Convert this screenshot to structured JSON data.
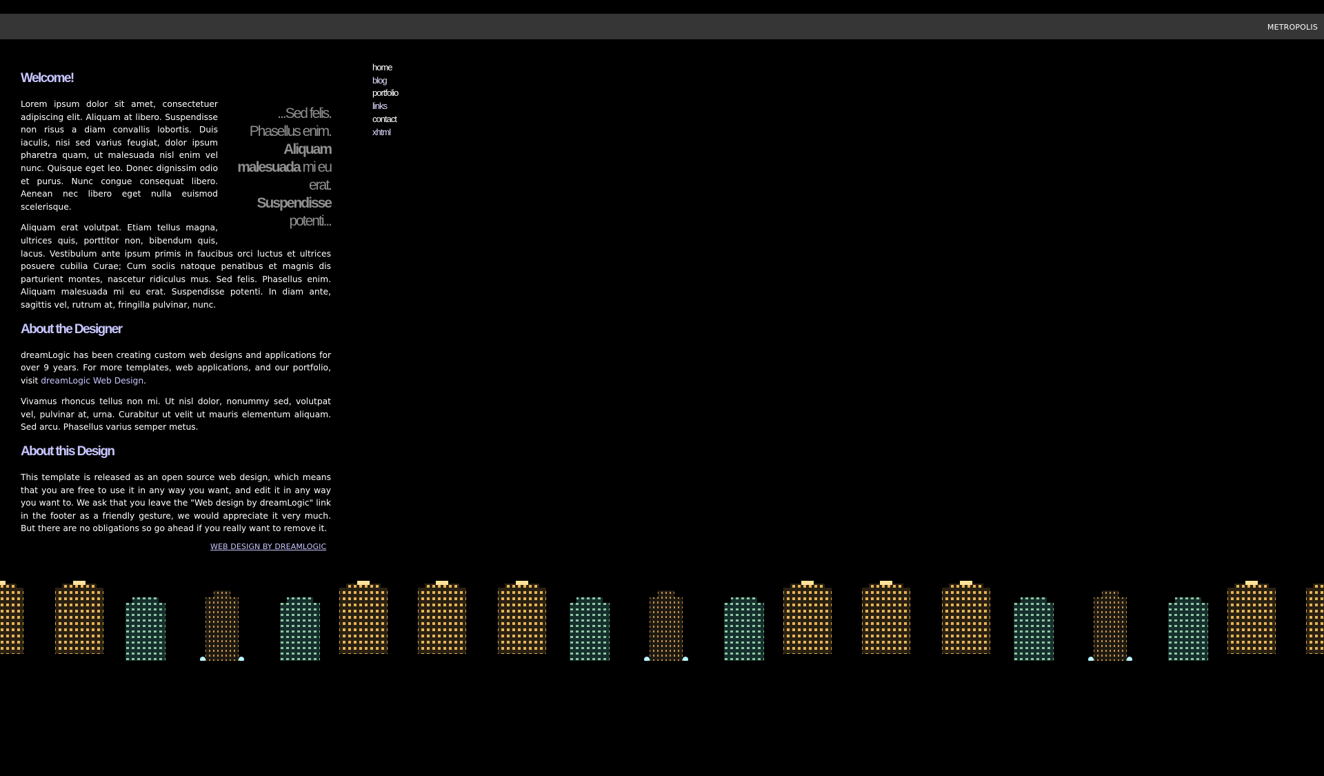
{
  "header": {
    "site_title": "METROPOLIS"
  },
  "main": {
    "welcome": {
      "heading": "Welcome!",
      "pullquote": {
        "line1": "...Sed felis.",
        "line2": "Phasellus enim.",
        "bold1": "Aliquam",
        "bold2": "malesuada",
        "line3": " mi eu",
        "line4": "erat.",
        "bold3": "Suspendisse",
        "line5": "potenti..."
      },
      "p1": "Lorem ipsum dolor sit amet, consectetuer adipiscing elit. Aliquam at libero. Suspendisse non risus a diam convallis lobortis. Duis iaculis, nisi sed varius feugiat, dolor ipsum pharetra quam, ut malesuada nisl enim vel nunc. Quisque eget leo. Donec dignissim odio et purus. Nunc congue consequat libero. Aenean nec libero eget nulla euismod scelerisque.",
      "p2": "Aliquam erat volutpat. Etiam tellus magna, ultrices quis, porttitor non, bibendum quis, lacus. Vestibulum ante ipsum primis in faucibus orci luctus et ultrices posuere cubilia Curae; Cum sociis natoque penatibus et magnis dis parturient montes, nascetur ridiculus mus. Sed felis. Phasellus enim. Aliquam malesuada mi eu erat. Suspendisse potenti. In diam ante, sagittis vel, rutrum at, fringilla pulvinar, nunc."
    },
    "designer": {
      "heading": "About the Designer",
      "p1_before": "dreamLogic has been creating custom web designs and applications for over 9 years. For more templates, web applications, and our portfolio, visit ",
      "p1_link": "dreamLogic Web Design",
      "p1_after": ".",
      "p2": "Vivamus rhoncus tellus non mi. Ut nisl dolor, nonummy sed, volutpat vel, pulvinar at, urna. Curabitur ut velit ut mauris elementum aliquam. Sed arcu. Phasellus varius semper metus."
    },
    "design": {
      "heading": "About this Design",
      "p1": "This template is released as an open source web design, which means that you are free to use it in any way you want, and edit it in any way you want to. We ask that you leave the \"Web design by dreamLogic\" link in the footer as a friendly gesture, we would appreciate it very much. But there are no obligations so go ahead if you really want to remove it."
    },
    "footer_link": "WEB DESIGN BY DREAMLOGIC"
  },
  "nav": {
    "items": [
      "home",
      "blog",
      "portfolio",
      "links",
      "contact",
      "xhtml"
    ]
  },
  "colors": {
    "background": "#000000",
    "topbar": "#363636",
    "heading": "#c7c6ff",
    "pullquote": "#8f8f8f",
    "window_light": "#ffd36a"
  }
}
